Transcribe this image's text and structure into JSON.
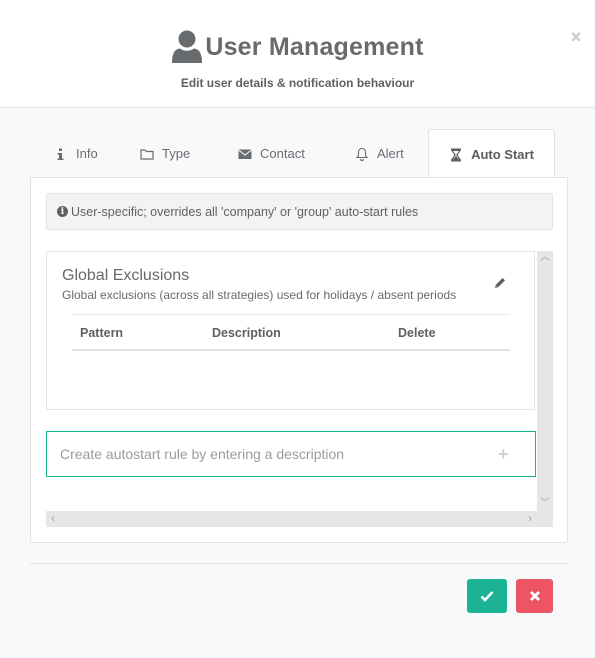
{
  "header": {
    "title": "User Management",
    "subtitle": "Edit user details & notification behaviour",
    "title_icon": "user-icon",
    "close_icon": "close-icon"
  },
  "tabs": [
    {
      "label": "Info",
      "icon": "info-icon",
      "active": false
    },
    {
      "label": "Type",
      "icon": "folder-icon",
      "active": false
    },
    {
      "label": "Contact",
      "icon": "envelope-icon",
      "active": false
    },
    {
      "label": "Alert",
      "icon": "bell-icon",
      "active": false
    },
    {
      "label": "Auto Start",
      "icon": "hourglass-icon",
      "active": true
    }
  ],
  "auto_start": {
    "info_text": "User-specific; overrides all 'company' or 'group' auto-start rules",
    "global_exclusions": {
      "title": "Global Exclusions",
      "subtitle": "Global exclusions (across all strategies) used for holidays / absent periods",
      "columns": [
        "Pattern",
        "Description",
        "Delete"
      ],
      "rows": []
    },
    "rule_input": {
      "value": "",
      "placeholder": "Create autostart rule by entering a description"
    }
  },
  "footer": {
    "confirm_icon": "check-icon",
    "cancel_icon": "close-icon"
  },
  "colors": {
    "primary": "#1ab394",
    "danger": "#ed5565",
    "text": "#676a6c"
  }
}
